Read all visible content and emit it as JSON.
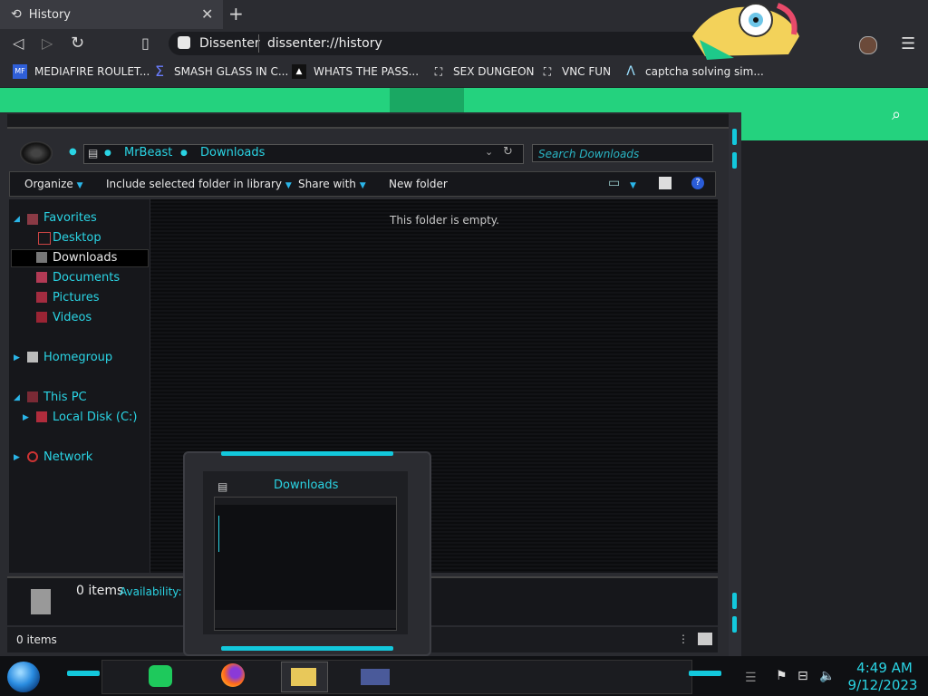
{
  "browser": {
    "tab_title": "History",
    "site_name": "Dissenter",
    "url": "dissenter://history",
    "bookmarks": [
      {
        "icon": "MF",
        "label": "MEDIAFIRE ROULET..."
      },
      {
        "icon": "Σ",
        "label": "SMASH GLASS IN C..."
      },
      {
        "icon": "▲",
        "label": "WHATS THE PASS..."
      },
      {
        "icon": "⛶",
        "label": "SEX DUNGEON"
      },
      {
        "icon": "⛶",
        "label": "VNC FUN"
      },
      {
        "icon": "Λ",
        "label": "captcha solving sim..."
      }
    ]
  },
  "explorer": {
    "breadcrumb": [
      "MrBeast",
      "Downloads"
    ],
    "search_placeholder": "Search Downloads",
    "toolbar": {
      "organize": "Organize",
      "include": "Include selected folder in library",
      "share": "Share with",
      "new_folder": "New folder"
    },
    "empty_message": "This folder is empty.",
    "nav": {
      "favorites": "Favorites",
      "desktop": "Desktop",
      "downloads": "Downloads",
      "documents": "Documents",
      "pictures": "Pictures",
      "videos": "Videos",
      "homegroup": "Homegroup",
      "this_pc": "This PC",
      "local_disk": "Local Disk (C:)",
      "network": "Network"
    },
    "details": {
      "items": "0 items",
      "availability": "Availability:"
    },
    "status_items": "0 items"
  },
  "preview": {
    "title": "Downloads"
  },
  "taskbar": {
    "time": "4:49 AM",
    "date": "9/12/2023"
  }
}
